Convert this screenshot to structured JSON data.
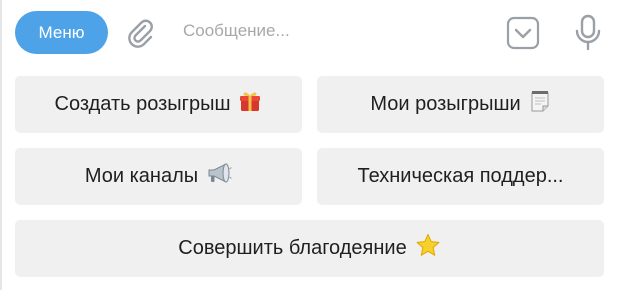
{
  "composer": {
    "menu_label": "Меню",
    "message_placeholder": "Сообщение...",
    "icons": [
      "paperclip-icon",
      "keyboard-toggle-icon",
      "microphone-icon"
    ]
  },
  "keyboard": {
    "buttons": [
      {
        "label": "Создать розыгрыш",
        "icon": "gift-icon"
      },
      {
        "label": "Мои розыгрыши",
        "icon": "notepad-icon"
      },
      {
        "label": "Мои каналы",
        "icon": "megaphone-icon"
      },
      {
        "label": "Техническая поддер...",
        "icon": null
      },
      {
        "label": "Совершить благодеяние",
        "icon": "star-icon"
      }
    ]
  },
  "colors": {
    "menu_button_bg": "#4ea3e8",
    "menu_button_text": "#ffffff",
    "keyboard_button_bg": "#f0f0f0",
    "keyboard_button_text": "#1f1f1f",
    "placeholder_text": "#a8a8a8",
    "icon_gray": "#9aa0a6"
  }
}
